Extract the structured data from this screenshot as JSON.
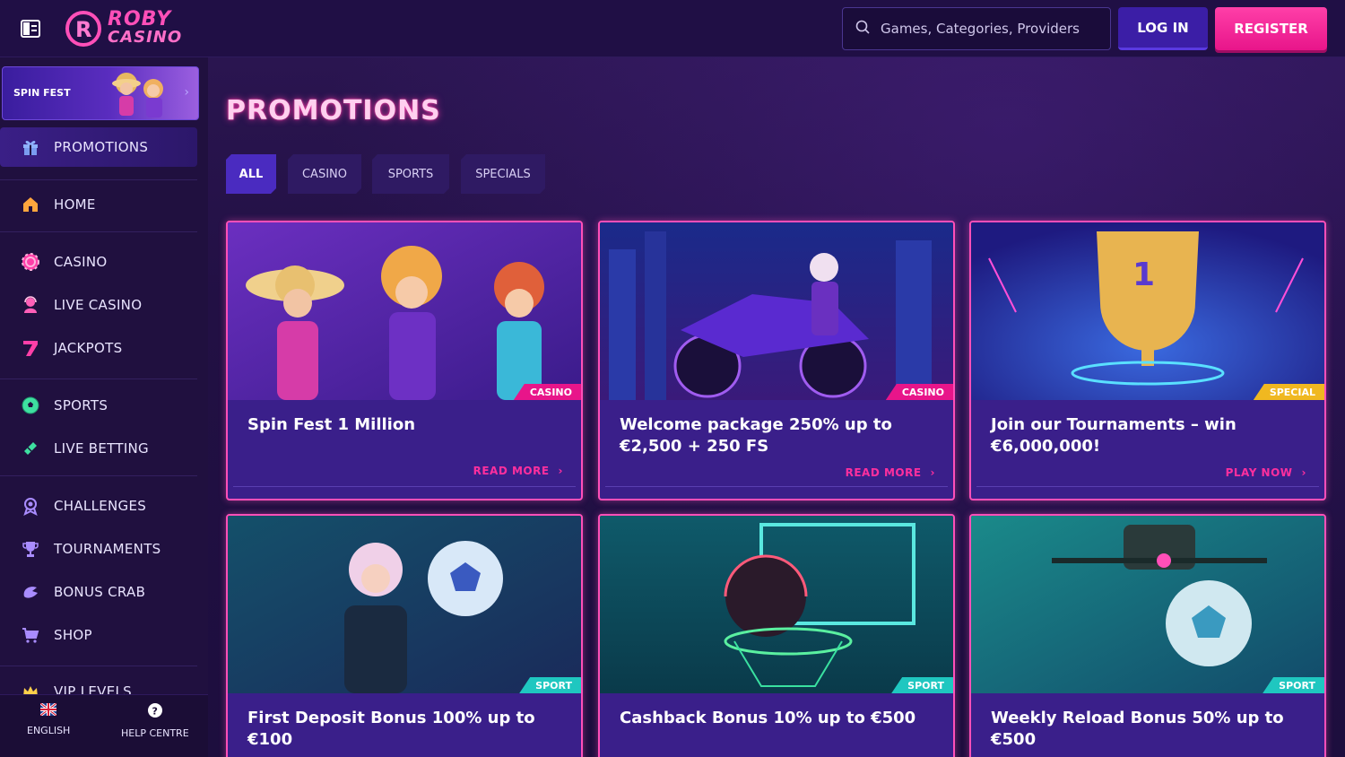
{
  "header": {
    "logo_line1": "ROBY",
    "logo_line2": "CASINO",
    "search_placeholder": "Games, Categories, Providers",
    "login_label": "LOG IN",
    "register_label": "REGISTER"
  },
  "sidebar": {
    "banner_label": "SPIN FEST",
    "promotions_label": "PROMOTIONS",
    "items": [
      {
        "label": "HOME",
        "icon": "home-icon"
      },
      {
        "label": "CASINO",
        "icon": "casino-chip-icon"
      },
      {
        "label": "LIVE CASINO",
        "icon": "live-dealer-icon"
      },
      {
        "label": "JACKPOTS",
        "icon": "seven-icon"
      },
      {
        "label": "SPORTS",
        "icon": "soccer-ball-icon"
      },
      {
        "label": "LIVE BETTING",
        "icon": "ticket-icon"
      },
      {
        "label": "CHALLENGES",
        "icon": "medal-icon"
      },
      {
        "label": "TOURNAMENTS",
        "icon": "trophy-icon"
      },
      {
        "label": "BONUS CRAB",
        "icon": "crab-claw-icon"
      },
      {
        "label": "SHOP",
        "icon": "cart-icon"
      },
      {
        "label": "VIP LEVELS",
        "icon": "crown-icon"
      }
    ],
    "footer": {
      "language_label": "ENGLISH",
      "help_label": "HELP CENTRE"
    }
  },
  "main": {
    "title": "PROMOTIONS",
    "filters": [
      "ALL",
      "CASINO",
      "SPORTS",
      "SPECIALS"
    ],
    "active_filter": "ALL",
    "cards": [
      {
        "title": "Spin Fest 1 Million",
        "badge": "CASINO",
        "cta": "READ MORE"
      },
      {
        "title": "Welcome package 250% up to €2,500 + 250 FS",
        "badge": "CASINO",
        "cta": "READ MORE"
      },
      {
        "title": "Join our Tournaments – win €6,000,000!",
        "badge": "SPECIAL",
        "cta": "PLAY NOW"
      },
      {
        "title": "First Deposit Bonus 100% up to €100",
        "badge": "SPORT",
        "cta": ""
      },
      {
        "title": "Cashback Bonus 10% up to €500",
        "badge": "SPORT",
        "cta": ""
      },
      {
        "title": "Weekly Reload Bonus 50% up to €500",
        "badge": "SPORT",
        "cta": ""
      }
    ]
  },
  "colors": {
    "accent_pink": "#ff2f9e",
    "card_border": "#ff4fb8",
    "casino_badge": "#e8158a",
    "special_badge": "#f0b820",
    "sport_badge": "#1fc7c0",
    "login_button": "#3b1ea6"
  }
}
